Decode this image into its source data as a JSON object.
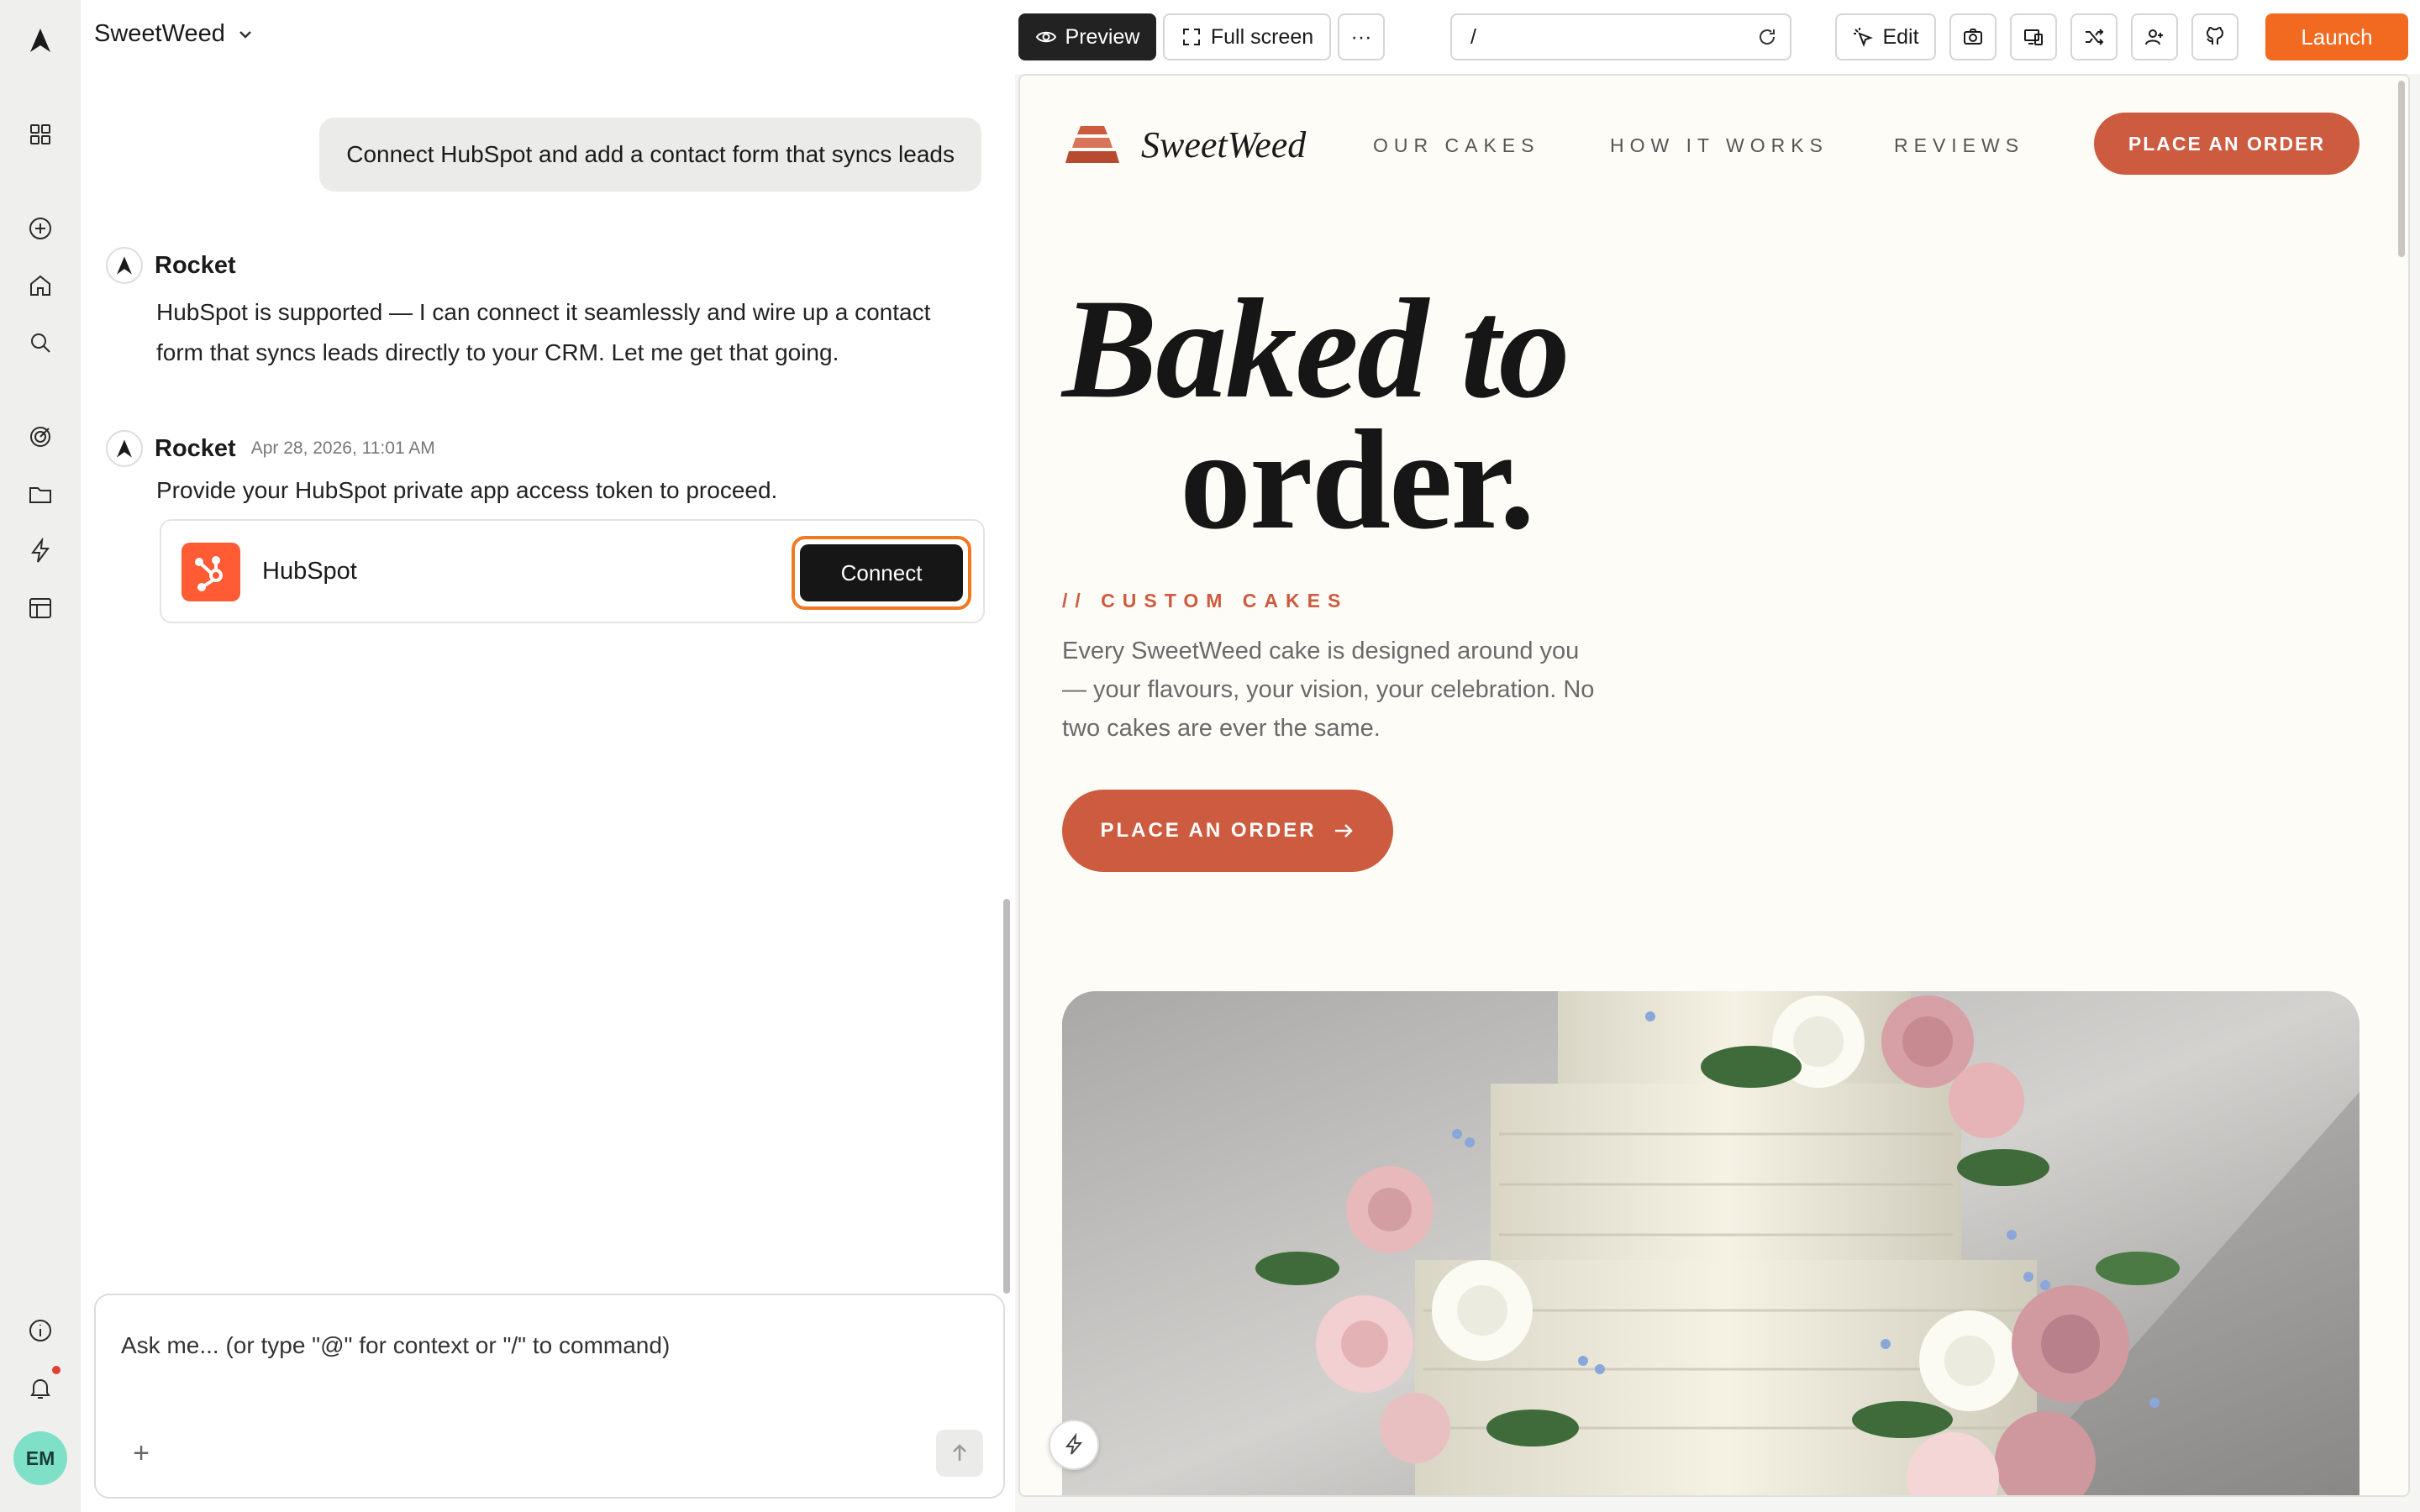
{
  "project": {
    "name": "SweetWeed"
  },
  "user_avatar": "EM",
  "chat": {
    "user_message": "Connect HubSpot and add a contact form that syncs leads",
    "messages": [
      {
        "sender": "Rocket",
        "time": "",
        "text": "HubSpot is supported — I can connect it seamlessly and wire up a contact form that syncs leads directly to your CRM. Let me get that going."
      },
      {
        "sender": "Rocket",
        "time": "Apr 28, 2026, 11:01 AM",
        "text": "Provide your HubSpot private app access token to proceed."
      }
    ],
    "integration": {
      "name": "HubSpot",
      "action": "Connect"
    },
    "composer": {
      "placeholder": "Ask me... (or type \"@\" for context or \"/\" to command)",
      "add": "+"
    }
  },
  "toolbar": {
    "preview": "Preview",
    "fullscreen": "Full screen",
    "more": "···",
    "url": "/",
    "edit": "Edit",
    "launch": "Launch"
  },
  "site": {
    "brand": "SweetWeed",
    "nav": [
      "OUR CAKES",
      "HOW IT WORKS",
      "REVIEWS"
    ],
    "cta_top": "PLACE AN ORDER",
    "hero_line1": "Baked to",
    "hero_line2": "order.",
    "kicker": "// CUSTOM CAKES",
    "description": "Every SweetWeed cake is designed around you — your flavours, your vision, your celebration. No two cakes are ever the same.",
    "cta_hero": "PLACE AN ORDER"
  },
  "colors": {
    "accent": "#f26a20",
    "brand_terracotta": "#cd5b40",
    "hubspot": "#ff5c35",
    "highlight": "#f07a21"
  }
}
